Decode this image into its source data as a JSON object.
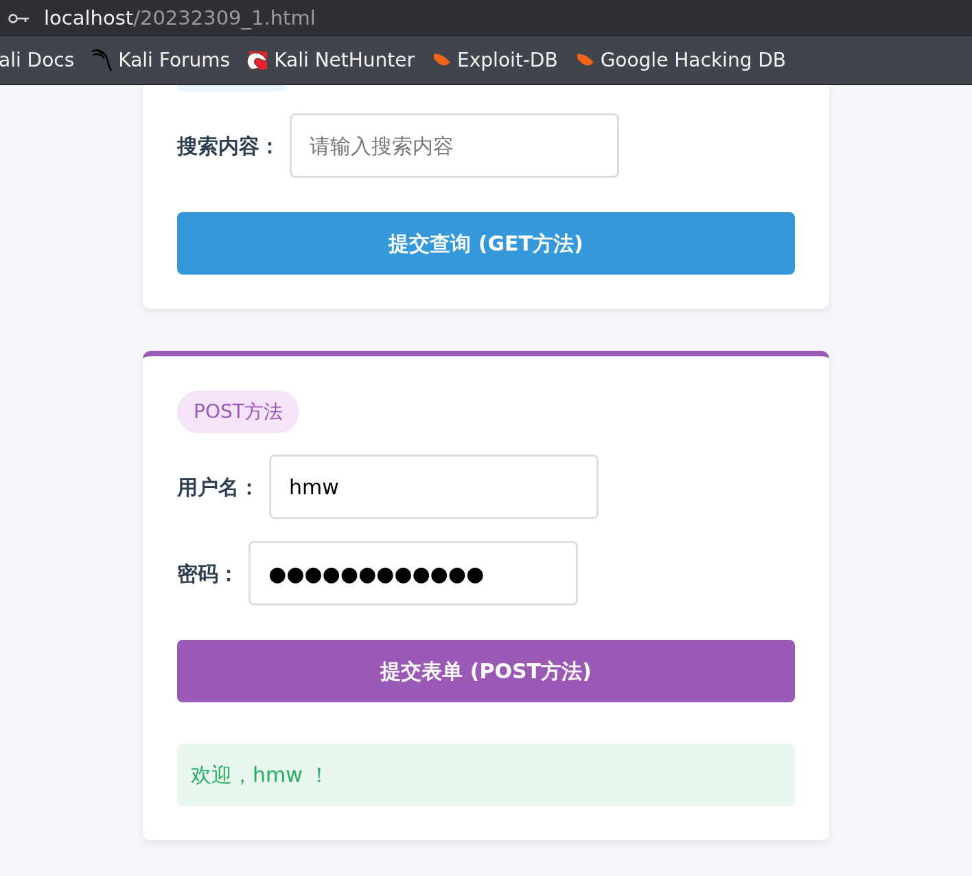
{
  "address_bar": {
    "host": "localhost",
    "path": "/20232309_1.html"
  },
  "bookmarks": [
    {
      "label": "ali Docs",
      "kind": "none"
    },
    {
      "label": "Kali Forums",
      "kind": "kali"
    },
    {
      "label": "Kali NetHunter",
      "kind": "nethunter"
    },
    {
      "label": "Exploit-DB",
      "kind": "exploit"
    },
    {
      "label": "Google Hacking DB",
      "kind": "exploit"
    }
  ],
  "get_form": {
    "label": "搜索内容：",
    "placeholder": "请输入搜索内容",
    "button": "提交查询 (GET方法)"
  },
  "post_form": {
    "badge": "POST方法",
    "fields": [
      {
        "label": "用户名：",
        "value": "hmw"
      },
      {
        "label": "密码：",
        "value": "●●●●●●●●●●●●"
      }
    ],
    "button": "提交表单 (POST方法)",
    "message": "欢迎，hmw ！"
  }
}
